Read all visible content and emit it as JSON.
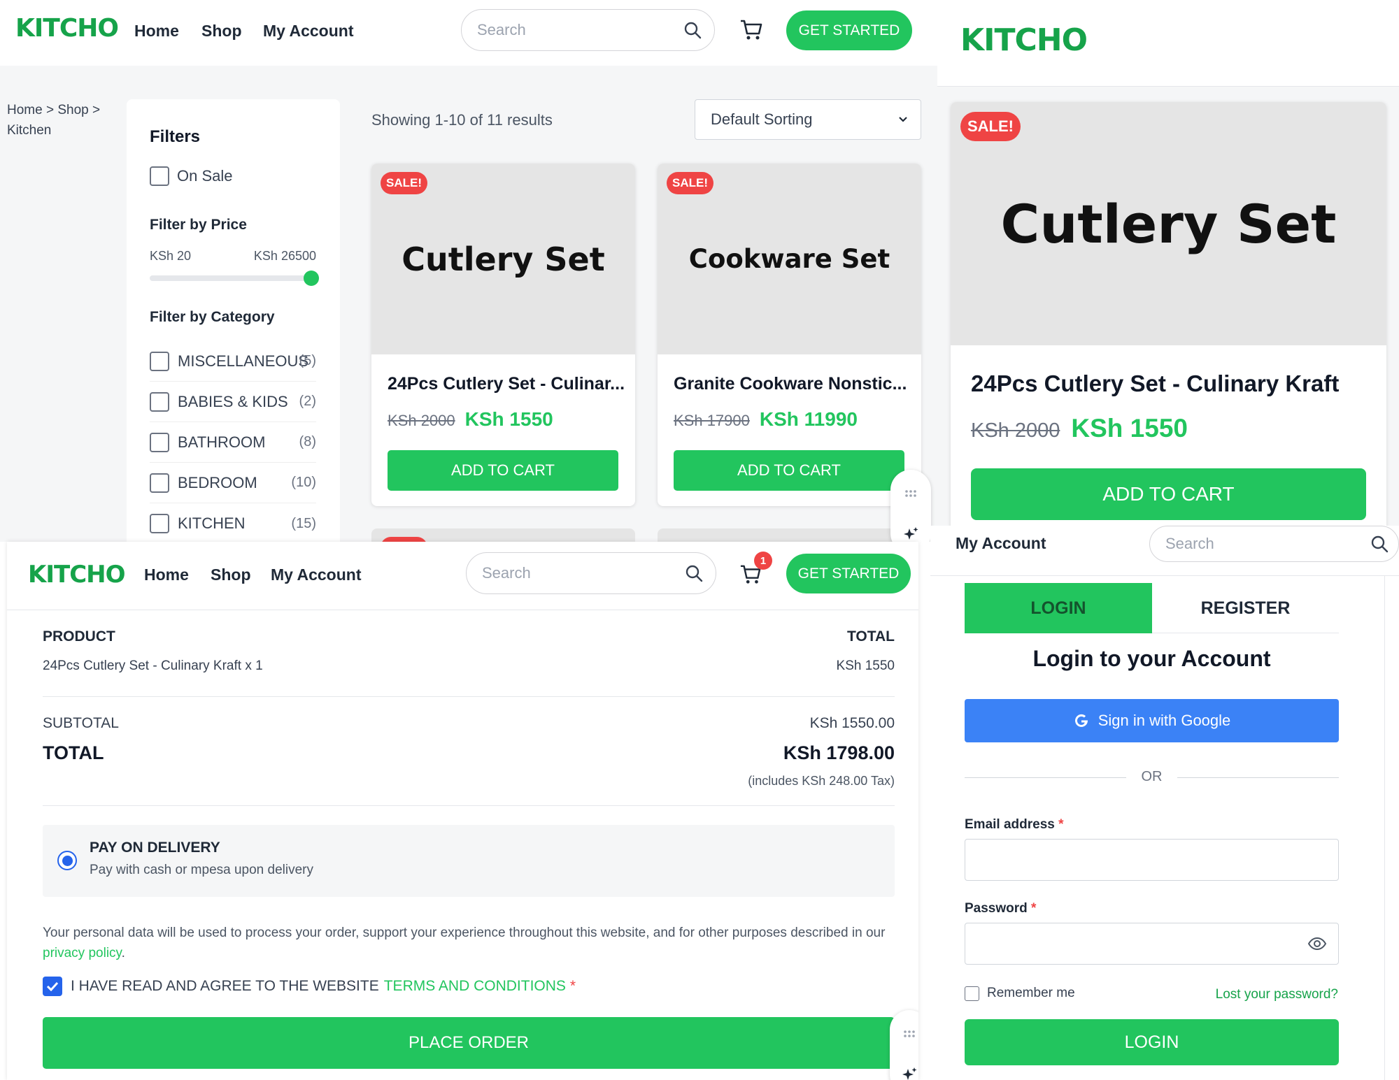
{
  "colors": {
    "brand_green": "#22c55e",
    "sale_red": "#ef4444",
    "google_blue": "#3b82f6"
  },
  "shop": {
    "logo": "KITCHO",
    "nav": [
      "Home",
      "Shop",
      "My Account"
    ],
    "search_placeholder": "Search",
    "cta": "GET STARTED",
    "breadcrumb": {
      "home": "Home",
      "sep1": ">",
      "shop": "Shop",
      "sep2": ">",
      "current": "Kitchen"
    },
    "filters": {
      "title": "Filters",
      "on_sale": "On Sale",
      "price_title": "Filter by Price",
      "price_min": "KSh 20",
      "price_max": "KSh 26500",
      "price_slider_fraction": 1.0,
      "category_title": "Filter by Category",
      "categories": [
        {
          "name": "MISCELLANEOUS",
          "count": "(5)"
        },
        {
          "name": "BABIES & KIDS",
          "count": "(2)"
        },
        {
          "name": "BATHROOM",
          "count": "(8)"
        },
        {
          "name": "BEDROOM",
          "count": "(10)"
        },
        {
          "name": "KITCHEN",
          "count": "(15)"
        }
      ]
    },
    "results_text": "Showing 1-10 of 11 results",
    "sorting": "Default Sorting",
    "products": [
      {
        "badge": "SALE!",
        "image_text": "Cutlery Set",
        "title": "24Pcs Cutlery Set - Culinar...",
        "old_price": "KSh 2000",
        "price": "KSh 1550",
        "button": "ADD TO CART"
      },
      {
        "badge": "SALE!",
        "image_text": "Cookware Set",
        "title": "Granite Cookware Nonstic...",
        "old_price": "KSh 17900",
        "price": "KSh 11990",
        "button": "ADD TO CART"
      }
    ]
  },
  "product_detail": {
    "logo": "KITCHO",
    "badge": "SALE!",
    "image_text": "Cutlery Set",
    "title": "24Pcs Cutlery Set - Culinary Kraft",
    "old_price": "KSh 2000",
    "price": "KSh 1550",
    "button": "ADD TO CART"
  },
  "checkout": {
    "logo": "KITCHO",
    "nav": [
      "Home",
      "Shop",
      "My Account"
    ],
    "search_placeholder": "Search",
    "cart_count": "1",
    "cta": "GET STARTED",
    "product_header": "PRODUCT",
    "total_header": "TOTAL",
    "line_item": "24Pcs Cutlery Set - Culinary Kraft x 1",
    "line_total": "KSh 1550",
    "subtotal_label": "SUBTOTAL",
    "subtotal_value": "KSh 1550.00",
    "total_label": "TOTAL",
    "total_value": "KSh 1798.00",
    "tax_note": "(includes KSh 248.00 Tax)",
    "payment_title": "PAY ON DELIVERY",
    "payment_desc": "Pay with cash or mpesa upon delivery",
    "privacy_text": "Your personal data will be used to process your order, support your experience throughout this website, and for other purposes described in our",
    "privacy_link": "privacy policy",
    "privacy_end": ".",
    "terms_prefix": "I HAVE READ AND AGREE TO THE WEBSITE",
    "terms_link": "TERMS AND CONDITIONS",
    "required": "*",
    "place_order": "PLACE ORDER"
  },
  "login": {
    "nav_account": "My Account",
    "search_placeholder": "Search",
    "tab_login": "LOGIN",
    "tab_register": "REGISTER",
    "heading": "Login to your Account",
    "google_button": "Sign in with Google",
    "or": "OR",
    "email_label": "Email address",
    "password_label": "Password",
    "required": "*",
    "remember": "Remember me",
    "lost_password": "Lost your password?",
    "login_button": "LOGIN"
  }
}
